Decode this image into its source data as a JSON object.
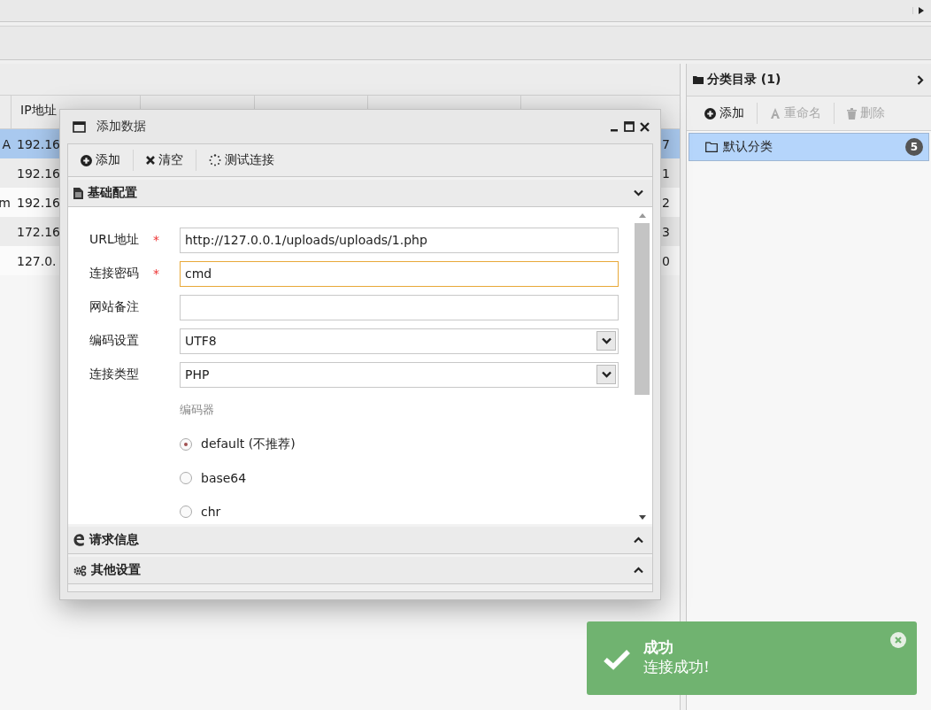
{
  "grid": {
    "columns": [
      "IP地址"
    ],
    "rows": [
      {
        "column_1": "A",
        "ip": "192.16",
        "column_last": "7",
        "selected": true
      },
      {
        "ip": "192.16",
        "column_last": "1",
        "selected": false
      },
      {
        "column_1": "m",
        "ip": "192.16",
        "column_last": "2",
        "selected": false
      },
      {
        "ip": "172.16",
        "column_last": "3",
        "selected": false
      },
      {
        "ip": "127.0.",
        "column_last": "0",
        "selected": false
      }
    ]
  },
  "category_panel": {
    "title": "分类目录 (1)",
    "toolbar": [
      {
        "label": "添加",
        "disabled": false
      },
      {
        "label": "重命名",
        "disabled": true
      },
      {
        "label": "删除",
        "disabled": true
      }
    ],
    "items": [
      {
        "label": "默认分类",
        "count": "5",
        "selected": true
      }
    ]
  },
  "dialog": {
    "title": "添加数据",
    "toolbar": [
      {
        "label": "添加"
      },
      {
        "label": "清空"
      },
      {
        "label": "测试连接"
      }
    ],
    "sections": [
      {
        "title": "基础配置",
        "expanded": true
      },
      {
        "title": "请求信息",
        "expanded": false
      },
      {
        "title": "其他设置",
        "expanded": false
      }
    ],
    "fields": [
      {
        "label": "URL地址",
        "required_mark": "*",
        "kind": "input",
        "value": "http://127.0.0.1/uploads/uploads/1.php",
        "focused": false
      },
      {
        "label": "连接密码",
        "required_mark": "*",
        "kind": "input",
        "value": "cmd",
        "focused": true
      },
      {
        "label": "网站备注",
        "kind": "input",
        "focused": false
      },
      {
        "label": "编码设置",
        "kind": "select",
        "value": "UTF8",
        "focused": false
      },
      {
        "label": "连接类型",
        "kind": "select",
        "value": "PHP",
        "focused": false
      }
    ],
    "encoder_heading": "编码器",
    "encoders": [
      {
        "label": "default (不推荐)",
        "selected": true
      },
      {
        "label": "base64",
        "selected": false
      },
      {
        "label": "chr",
        "selected": false
      }
    ]
  },
  "toast": {
    "title": "成功",
    "message": "连接成功!"
  }
}
